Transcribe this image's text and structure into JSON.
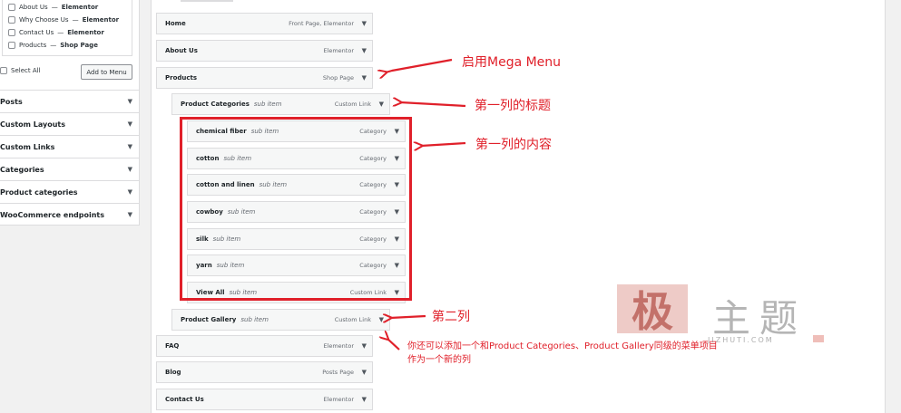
{
  "pages_box": {
    "items": [
      {
        "name": "About Us",
        "suffix": "Elementor"
      },
      {
        "name": "Why Choose Us",
        "suffix": "Elementor"
      },
      {
        "name": "Contact Us",
        "suffix": "Elementor"
      },
      {
        "name": "Products",
        "suffix": "Shop Page"
      }
    ],
    "separator": "—",
    "select_all": "Select All",
    "add_button": "Add to Menu"
  },
  "accordion": [
    "Posts",
    "Custom Layouts",
    "Custom Links",
    "Categories",
    "Product categories",
    "WooCommerce endpoints"
  ],
  "menu": {
    "sub_item_label": "sub item",
    "top_items": [
      {
        "title": "Home",
        "type": "Front Page, Elementor"
      },
      {
        "title": "About Us",
        "type": "Elementor"
      },
      {
        "title": "Products",
        "type": "Shop Page"
      },
      {
        "title": "FAQ",
        "type": "Elementor"
      },
      {
        "title": "Blog",
        "type": "Posts Page"
      },
      {
        "title": "Contact Us",
        "type": "Elementor"
      }
    ],
    "columns": [
      {
        "title": "Product Categories",
        "type": "Custom Link"
      },
      {
        "title": "Product Gallery",
        "type": "Custom Link"
      }
    ],
    "column_items": [
      {
        "title": "chemical fiber",
        "type": "Category"
      },
      {
        "title": "cotton",
        "type": "Category"
      },
      {
        "title": "cotton and linen",
        "type": "Category"
      },
      {
        "title": "cowboy",
        "type": "Category"
      },
      {
        "title": "silk",
        "type": "Category"
      },
      {
        "title": "yarn",
        "type": "Category"
      },
      {
        "title": "View All",
        "type": "Custom Link"
      }
    ]
  },
  "annotations": {
    "mega_menu": "启用Mega Menu",
    "first_col_title": "第一列的标题",
    "first_col_content": "第一列的内容",
    "second_col": "第二列",
    "new_col_line1": "你还可以添加一个和Product Categories、Product Gallery同级的菜单项目",
    "new_col_line2": "作为一个新的列"
  },
  "watermark": {
    "logo": "极",
    "text": "主题",
    "url": "JIZHUTI.COM"
  },
  "colors": {
    "annotation_red": "#e0202a",
    "item_bg": "#f6f7f7",
    "border": "#dcdcde"
  }
}
